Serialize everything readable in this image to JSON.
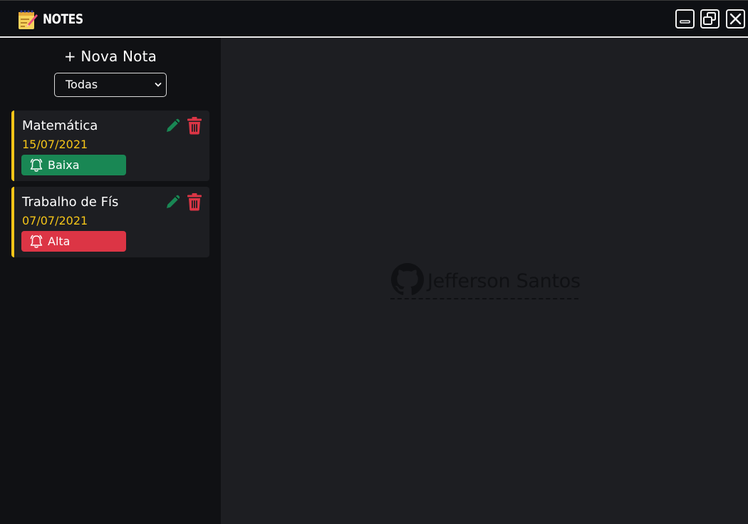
{
  "app": {
    "title": "NOTES",
    "icon": "notepad-pencil-icon"
  },
  "window_controls": {
    "minimize_icon": "minimize-icon",
    "restore_icon": "restore-icon",
    "close_icon": "close-icon"
  },
  "sidebar": {
    "new_note_label": "+ Nova Nota",
    "filter": {
      "selected": "Todas"
    },
    "notes": [
      {
        "title": "Matemática",
        "date": "15/07/2021",
        "priority": "Baixa",
        "priority_color": "#198754",
        "accent_color": "#f5c518"
      },
      {
        "title": "Trabalho de Fís",
        "date": "07/07/2021",
        "priority": "Alta",
        "priority_color": "#dc3545",
        "accent_color": "#f5c518"
      }
    ]
  },
  "main": {
    "credit_name": "Jefferson Santos",
    "credit_icon": "github-icon"
  },
  "colors": {
    "accent": "#f5c518",
    "edit_icon": "#198754",
    "delete_icon": "#dc3545"
  }
}
